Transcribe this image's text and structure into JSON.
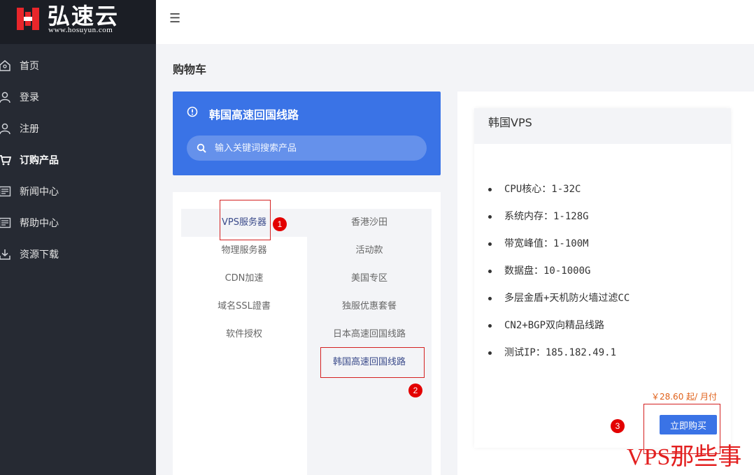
{
  "brand": {
    "name": "弘速云",
    "domain": "www.hosuyun.com"
  },
  "sidebar": {
    "items": [
      {
        "label": "首页",
        "icon": "home-icon"
      },
      {
        "label": "登录",
        "icon": "user-icon"
      },
      {
        "label": "注册",
        "icon": "user-icon"
      },
      {
        "label": "订购产品",
        "icon": "cart-icon"
      },
      {
        "label": "新闻中心",
        "icon": "list-icon"
      },
      {
        "label": "帮助中心",
        "icon": "list-icon"
      },
      {
        "label": "资源下载",
        "icon": "download-icon"
      }
    ]
  },
  "page": {
    "title": "购物车"
  },
  "search_card": {
    "title": "韩国高速回国线路",
    "placeholder": "输入关键词搜索产品"
  },
  "categories": {
    "left": [
      "VPS服务器",
      "物理服务器",
      "CDN加速",
      "域名SSL證書",
      "软件授权"
    ],
    "right": [
      "香港沙田",
      "活动款",
      "美国专区",
      "独服优惠套餐",
      "日本高速回国线路",
      "韩国高速回国线路"
    ]
  },
  "product": {
    "name": "韩国VPS",
    "specs": [
      "CPU核心：1-32C",
      "系统内存：1-128G",
      "带宽峰值：1-100M",
      "数据盘：10-1000G",
      "多层金盾+天机防火墙过滤CC",
      "CN2+BGP双向精品线路",
      "测试IP：185.182.49.1"
    ],
    "price": "￥28.60 起/ 月付",
    "buy_label": "立即购买"
  },
  "annotations": [
    "1",
    "2",
    "3"
  ],
  "watermark": "VPS那些事",
  "colors": {
    "sidebar": "#262a33",
    "accent": "#3a73e6",
    "price": "#e0611a",
    "annotation": "#e30000"
  }
}
